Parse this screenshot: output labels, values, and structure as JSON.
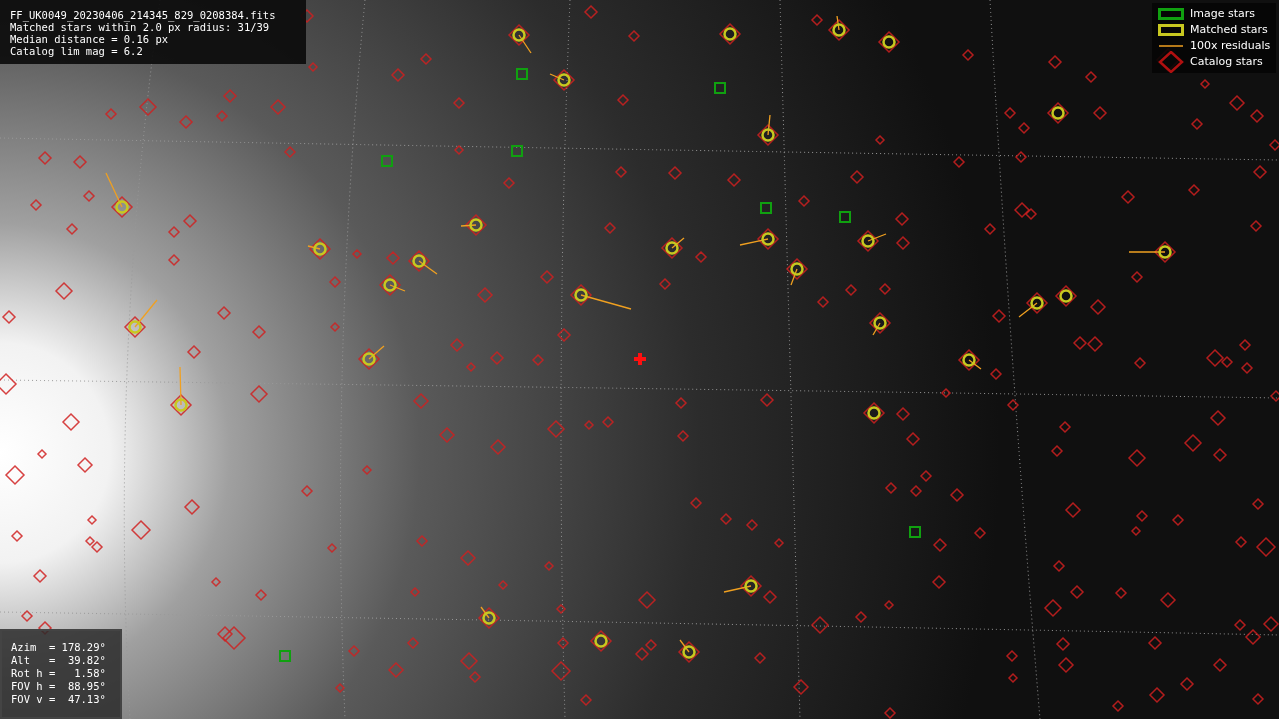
{
  "file_info": {
    "lines": [
      "FF_UK0049_20230406_214345_829_0208384.fits",
      "Matched stars within 2.0 px radius: 31/39",
      "Median distance = 0.16 px",
      "Catalog lim mag = 6.2"
    ]
  },
  "legend": {
    "items": [
      {
        "kind": "image",
        "label": "Image stars"
      },
      {
        "kind": "matched",
        "label": "Matched stars"
      },
      {
        "kind": "residual",
        "label": "100x residuals"
      },
      {
        "kind": "catalog",
        "label": "Catalog stars"
      }
    ]
  },
  "pointing": {
    "lines": [
      "Azim  = 178.29°",
      "Alt   =  39.82°",
      "Rot h =   1.58°",
      "FOV h =  88.95°",
      "FOV v =  47.13°"
    ]
  }
}
